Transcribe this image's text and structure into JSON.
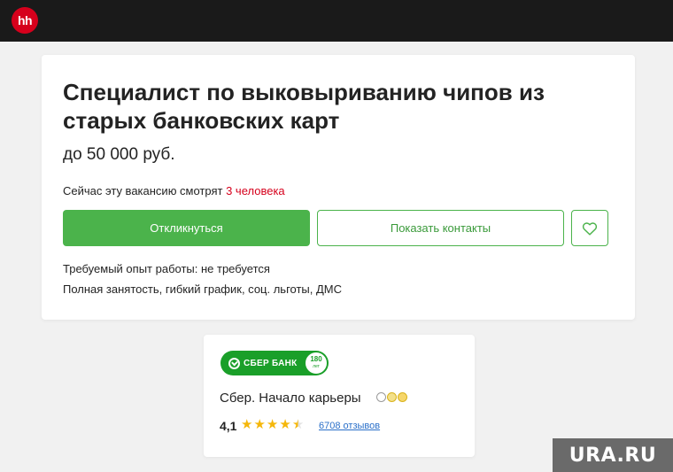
{
  "topbar": {
    "logo_text": "hh"
  },
  "vacancy": {
    "title": "Специалист по выковыриванию чипов из старых банковских карт",
    "salary": "до 50 000 руб.",
    "viewers_prefix": "Сейчас эту вакансию смотрят ",
    "viewers_count": "3 человека",
    "apply_label": "Откликнуться",
    "contacts_label": "Показать контакты",
    "favorite_icon": "heart-icon",
    "experience": "Требуемый опыт работы: не требуется",
    "employment": "Полная занятость, гибкий график, соц. льготы, ДМС"
  },
  "company": {
    "logo_text": "СБЕР БАНК",
    "logo_badge_number": "180",
    "logo_badge_label": "лет",
    "name": "Сбер. Начало карьеры",
    "rating": "4,1",
    "rating_stars": 4.5,
    "reviews_label": "6708 отзывов"
  },
  "watermark": {
    "text": "URA.RU"
  },
  "colors": {
    "accent_green": "#4bb34b",
    "hh_red": "#d6001c",
    "sber_green": "#1a9f29",
    "star_gold": "#f5b70a",
    "link_blue": "#2a6fc9"
  }
}
